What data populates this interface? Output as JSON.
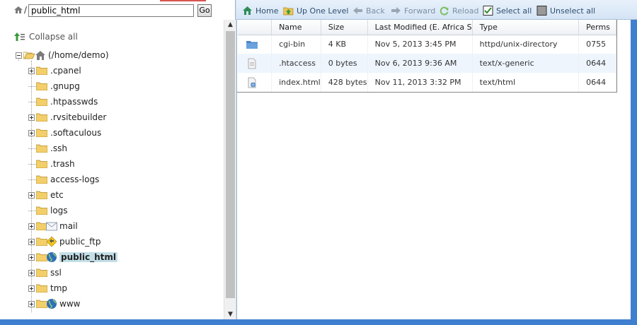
{
  "path_bar": {
    "value": "public_html",
    "separator": "/",
    "go_label": "Go"
  },
  "tree": {
    "collapse_label": "Collapse all",
    "root_label": "(/home/demo)",
    "items": [
      {
        "label": ".cpanel",
        "expandable": true
      },
      {
        "label": ".gnupg",
        "expandable": false
      },
      {
        "label": ".htpasswds",
        "expandable": false
      },
      {
        "label": ".rvsitebuilder",
        "expandable": true
      },
      {
        "label": ".softaculous",
        "expandable": true
      },
      {
        "label": ".ssh",
        "expandable": false
      },
      {
        "label": ".trash",
        "expandable": false
      },
      {
        "label": "access-logs",
        "expandable": false
      },
      {
        "label": "etc",
        "expandable": true
      },
      {
        "label": "logs",
        "expandable": false
      },
      {
        "label": "mail",
        "expandable": true,
        "overlay": "mail-icon"
      },
      {
        "label": "public_ftp",
        "expandable": true,
        "overlay": "ftp-warning-icon"
      },
      {
        "label": "public_html",
        "expandable": true,
        "overlay": "globe-icon",
        "selected": true
      },
      {
        "label": "ssl",
        "expandable": true
      },
      {
        "label": "tmp",
        "expandable": true
      },
      {
        "label": "www",
        "expandable": true,
        "overlay": "globe-icon"
      }
    ]
  },
  "toolbar": {
    "home": "Home",
    "up": "Up One Level",
    "back": "Back",
    "forward": "Forward",
    "reload": "Reload",
    "select_all": "Select all",
    "unselect_all": "Unselect all"
  },
  "files": {
    "columns": [
      "Name",
      "Size",
      "Last Modified (E. Africa S",
      "Type",
      "Perms"
    ],
    "rows": [
      {
        "icon": "folder-icon",
        "name": "cgi-bin",
        "size": "4 KB",
        "modified": "Nov 5, 2013 3:45 PM",
        "type": "httpd/unix-directory",
        "perms": "0755"
      },
      {
        "icon": "text-file-icon",
        "name": ".htaccess",
        "size": "0 bytes",
        "modified": "Nov 6, 2013 9:36 AM",
        "type": "text/x-generic",
        "perms": "0644"
      },
      {
        "icon": "html-file-icon",
        "name": "index.html",
        "size": "428 bytes",
        "modified": "Nov 11, 2013 3:32 PM",
        "type": "text/html",
        "perms": "0644"
      }
    ]
  },
  "colors": {
    "accent": "#3f7fd0",
    "selection": "#c3dfe8",
    "row_alt": "#eef5fd"
  }
}
